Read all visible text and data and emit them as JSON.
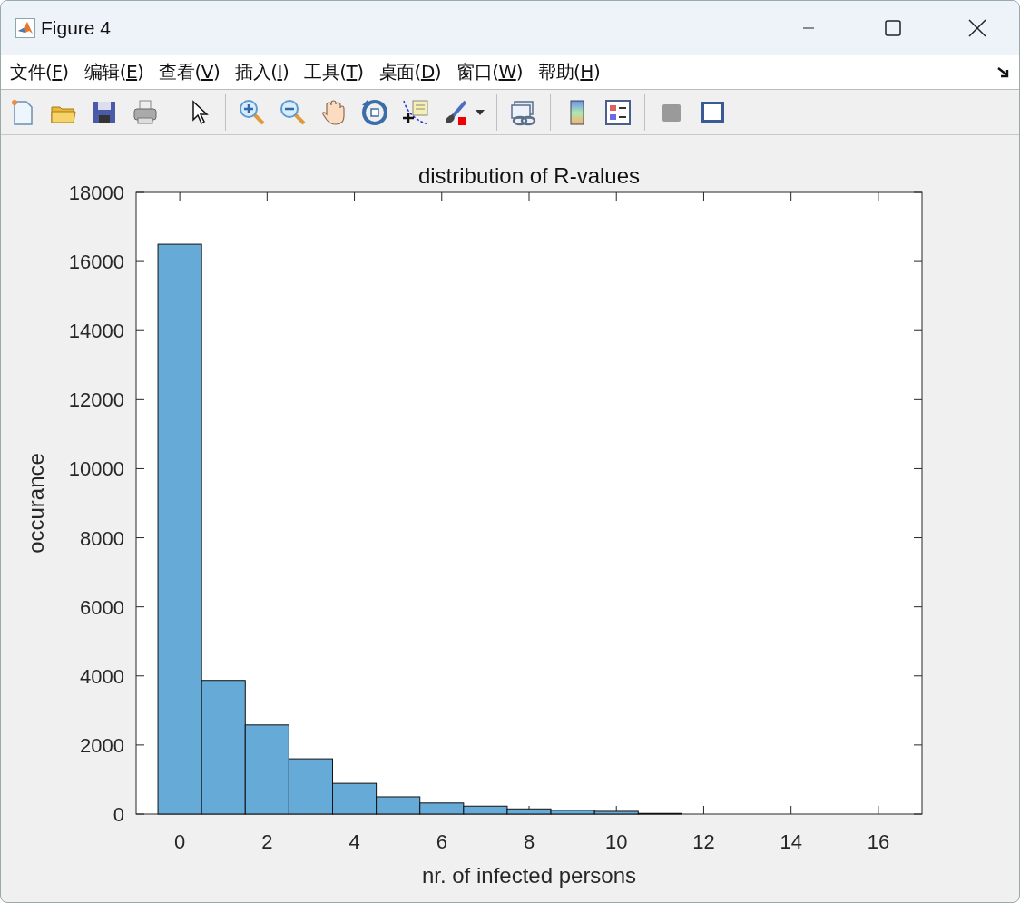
{
  "window": {
    "title": "Figure 4"
  },
  "menu": [
    {
      "label": "文件(F)"
    },
    {
      "label": "编辑(E)"
    },
    {
      "label": "查看(V)"
    },
    {
      "label": "插入(I)"
    },
    {
      "label": "工具(T)"
    },
    {
      "label": "桌面(D)"
    },
    {
      "label": "窗口(W)"
    },
    {
      "label": "帮助(H)"
    }
  ],
  "figure": {
    "chart_data": {
      "type": "bar",
      "title": "distribution of R-values",
      "xlabel": "nr. of infected persons",
      "ylabel": "occurance",
      "x": [
        0,
        1,
        2,
        3,
        4,
        5,
        6,
        7,
        8,
        9,
        10,
        11
      ],
      "series": [
        {
          "color": "#66aad7",
          "values": [
            16500,
            3870,
            2580,
            1600,
            890,
            500,
            320,
            230,
            150,
            110,
            80,
            20
          ]
        }
      ],
      "xlim": [
        -1,
        17
      ],
      "ylim": [
        0,
        18000
      ],
      "xticks": [
        0,
        2,
        4,
        6,
        8,
        10,
        12,
        14,
        16
      ],
      "yticks": [
        0,
        2000,
        4000,
        6000,
        8000,
        10000,
        12000,
        14000,
        16000,
        18000
      ]
    }
  }
}
